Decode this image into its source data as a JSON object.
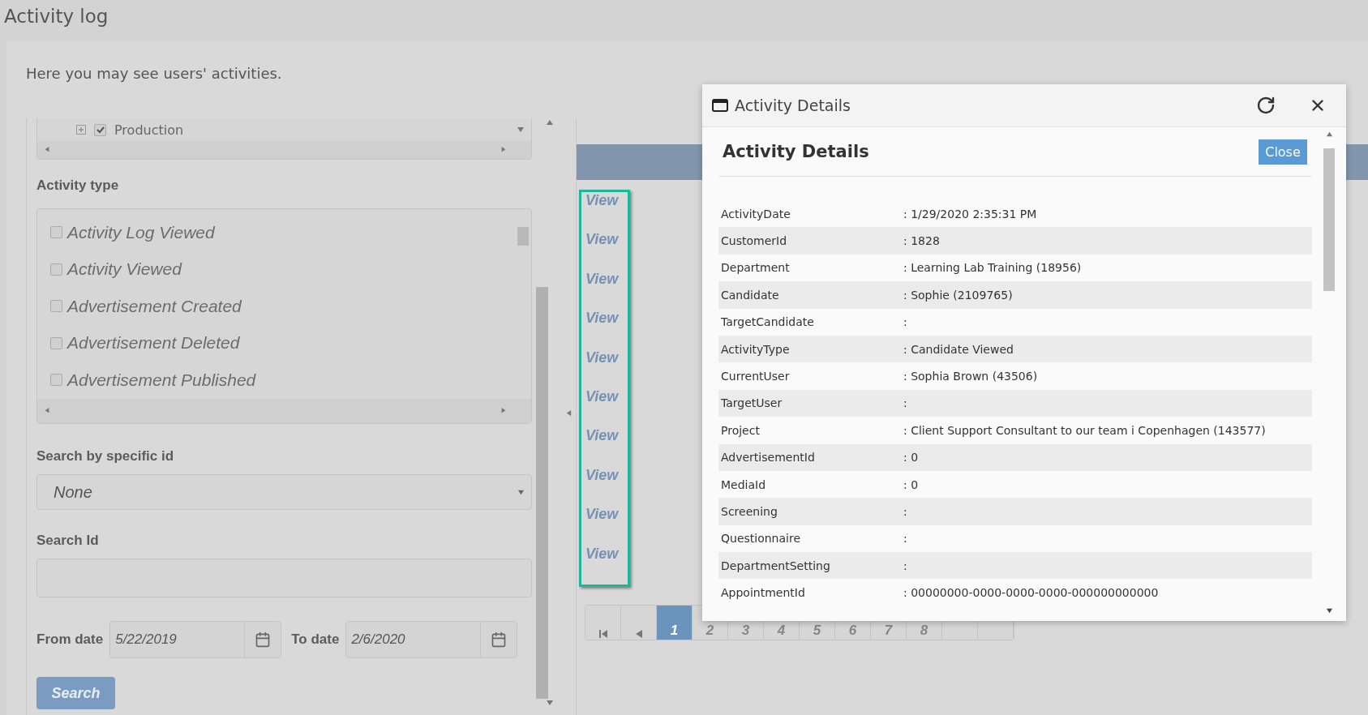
{
  "page": {
    "title": "Activity log",
    "description": "Here you may see users' activities."
  },
  "filters": {
    "tree": {
      "items": [
        {
          "label": "Production",
          "checked": true
        }
      ]
    },
    "activity_type": {
      "label": "Activity type",
      "items": [
        {
          "label": "Activity Log Viewed",
          "checked": false
        },
        {
          "label": "Activity Viewed",
          "checked": false
        },
        {
          "label": "Advertisement Created",
          "checked": false
        },
        {
          "label": "Advertisement Deleted",
          "checked": false
        },
        {
          "label": "Advertisement Published",
          "checked": false
        }
      ]
    },
    "search_by_id": {
      "label": "Search by specific id",
      "value": "None"
    },
    "search_id": {
      "label": "Search Id"
    },
    "from_date": {
      "label": "From date",
      "value": "5/22/2019"
    },
    "to_date": {
      "label": "To date",
      "value": "2/6/2020"
    },
    "search_button": "Search"
  },
  "grid": {
    "rows": [
      {
        "action": "View"
      },
      {
        "action": "View"
      },
      {
        "action": "View"
      },
      {
        "action": "View"
      },
      {
        "action": "View"
      },
      {
        "action": "View"
      },
      {
        "action": "View"
      },
      {
        "action": "View"
      },
      {
        "action": "View"
      },
      {
        "action": "View"
      }
    ]
  },
  "pagination": {
    "pages": [
      {
        "label": "1",
        "selected": true
      },
      {
        "label": "2",
        "selected": false
      },
      {
        "label": "3",
        "selected": false
      },
      {
        "label": "4",
        "selected": false
      },
      {
        "label": "5",
        "selected": false
      },
      {
        "label": "6",
        "selected": false
      },
      {
        "label": "7",
        "selected": false
      },
      {
        "label": "8",
        "selected": false
      }
    ]
  },
  "dialog": {
    "title": "Activity Details",
    "heading": "Activity Details",
    "close_button": "Close",
    "fields": [
      {
        "label": "ActivityDate",
        "value": ": 1/29/2020 2:35:31 PM"
      },
      {
        "label": "CustomerId",
        "value": ": 1828"
      },
      {
        "label": "Department",
        "value": ": Learning Lab Training (18956)"
      },
      {
        "label": "Candidate",
        "value": ": Sophie (2109765)"
      },
      {
        "label": "TargetCandidate",
        "value": ":"
      },
      {
        "label": "ActivityType",
        "value": ": Candidate Viewed"
      },
      {
        "label": "CurrentUser",
        "value": ": Sophia Brown (43506)"
      },
      {
        "label": "TargetUser",
        "value": ":"
      },
      {
        "label": "Project",
        "value": ": Client Support Consultant to our team i Copenhagen (143577)"
      },
      {
        "label": "AdvertisementId",
        "value": ": 0"
      },
      {
        "label": "MediaId",
        "value": ": 0"
      },
      {
        "label": "Screening",
        "value": ":"
      },
      {
        "label": "Questionnaire",
        "value": ":"
      },
      {
        "label": "DepartmentSetting",
        "value": ":"
      },
      {
        "label": "AppointmentId",
        "value": ": 00000000-0000-0000-0000-000000000000"
      }
    ]
  }
}
